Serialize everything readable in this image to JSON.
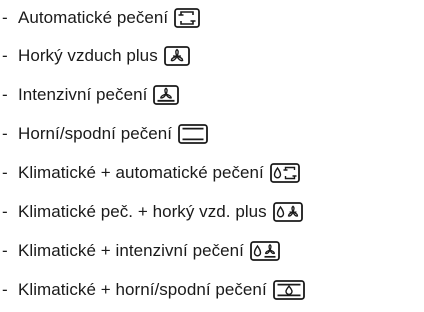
{
  "list": {
    "items": [
      {
        "dash": "-",
        "label": "Automatické pečení",
        "icon": "auto-bake-icon"
      },
      {
        "dash": "-",
        "label": "Horký vzduch plus",
        "icon": "fan-plus-icon"
      },
      {
        "dash": "-",
        "label": "Intenzivní pečení",
        "icon": "intensive-bake-icon"
      },
      {
        "dash": "-",
        "label": "Horní/spodní pečení",
        "icon": "top-bottom-heat-icon"
      },
      {
        "dash": "-",
        "label": "Klimatické + automatické pečení",
        "icon": "climate-auto-bake-icon"
      },
      {
        "dash": "-",
        "label": "Klimatické peč. + horký vzd. plus",
        "icon": "climate-fan-plus-icon"
      },
      {
        "dash": "-",
        "label": "Klimatické + intenzivní pečení",
        "icon": "climate-intensive-bake-icon"
      },
      {
        "dash": "-",
        "label": "Klimatické + horní/spodní pečení",
        "icon": "climate-top-bottom-heat-icon"
      }
    ]
  },
  "colors": {
    "text": "#1a1a1a",
    "icon_stroke": "#1a1a1a",
    "background": "#ffffff"
  }
}
